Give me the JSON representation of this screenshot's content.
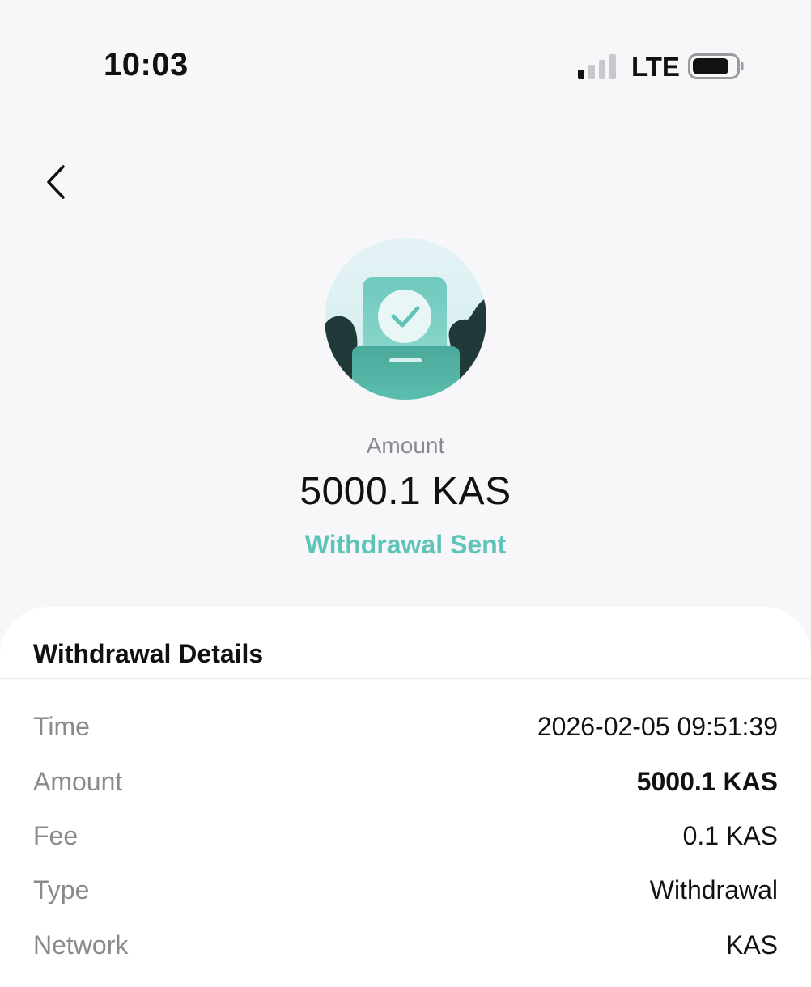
{
  "status_bar": {
    "time": "10:03",
    "network": "LTE",
    "signal_icon": "cellular-signal-icon",
    "battery_icon": "battery-icon"
  },
  "nav": {
    "back_icon": "chevron-left-icon"
  },
  "summary": {
    "illustration": "withdrawal-success-illustration",
    "amount_label": "Amount",
    "amount_value": "5000.1 KAS",
    "status": "Withdrawal Sent",
    "status_color": "#5fc4b8"
  },
  "details": {
    "title": "Withdrawal Details",
    "rows": [
      {
        "label": "Time",
        "value": "2026-02-05 09:51:39"
      },
      {
        "label": "Amount",
        "value": "5000.1 KAS"
      },
      {
        "label": "Fee",
        "value": "0.1 KAS"
      },
      {
        "label": "Type",
        "value": "Withdrawal"
      },
      {
        "label": "Network",
        "value": "KAS"
      }
    ]
  },
  "colors": {
    "background": "#f7f7fa",
    "accent": "#5fc4b8",
    "card": "#ffffff"
  }
}
